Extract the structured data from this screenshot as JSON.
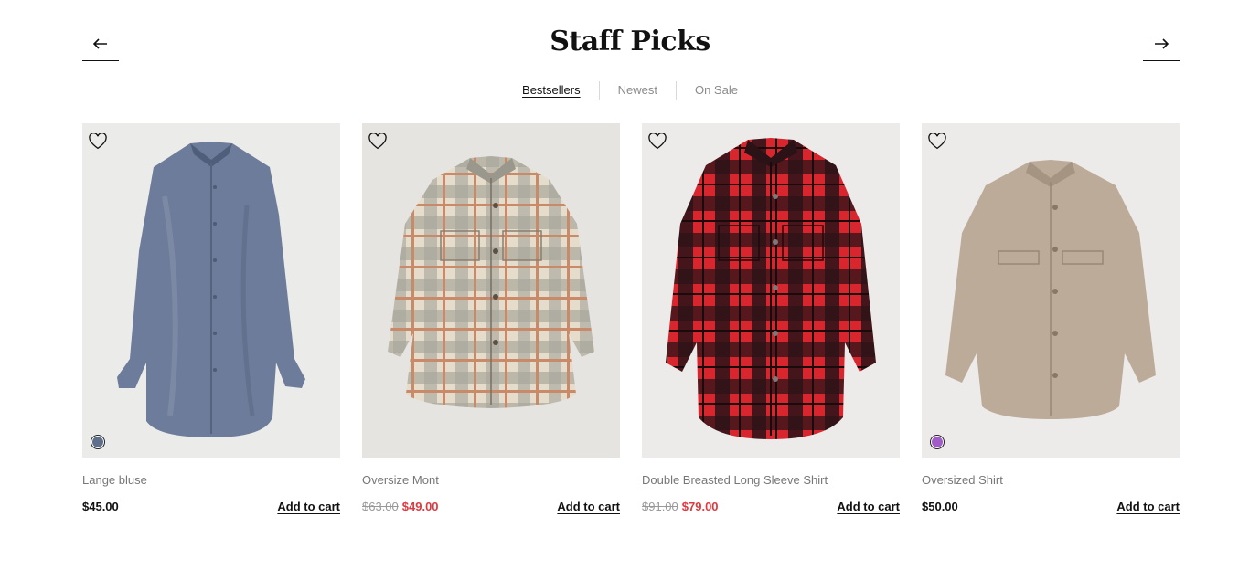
{
  "header": {
    "title": "Staff Picks",
    "prev_icon": "arrow-left-icon",
    "next_icon": "arrow-right-icon"
  },
  "tabs": [
    {
      "label": "Bestsellers",
      "active": true
    },
    {
      "label": "Newest",
      "active": false
    },
    {
      "label": "On Sale",
      "active": false
    }
  ],
  "colors": {
    "sale": "#e0383e",
    "text": "#111111",
    "muted": "#777777"
  },
  "products": [
    {
      "name": "Lange bluse",
      "price": "$45.00",
      "old_price": "",
      "sale_price": "",
      "cart_label": "Add to cart",
      "swatch_color": "#5e6f8c",
      "garment": "satin shirt, dusty blue"
    },
    {
      "name": "Oversize Mont",
      "price": "",
      "old_price": "$63.00",
      "sale_price": "$49.00",
      "cart_label": "Add to cart",
      "swatch_color": "",
      "garment": "plaid shacket, beige/grey/rust"
    },
    {
      "name": "Double Breasted Long Sleeve Shirt",
      "price": "",
      "old_price": "$91.00",
      "sale_price": "$79.00",
      "cart_label": "Add to cart",
      "swatch_color": "",
      "garment": "plaid shirt coat, red/black"
    },
    {
      "name": "Oversized Shirt",
      "price": "$50.00",
      "old_price": "",
      "sale_price": "",
      "cart_label": "Add to cart",
      "swatch_color": "#a05cc8",
      "garment": "wool shacket, taupe"
    }
  ]
}
